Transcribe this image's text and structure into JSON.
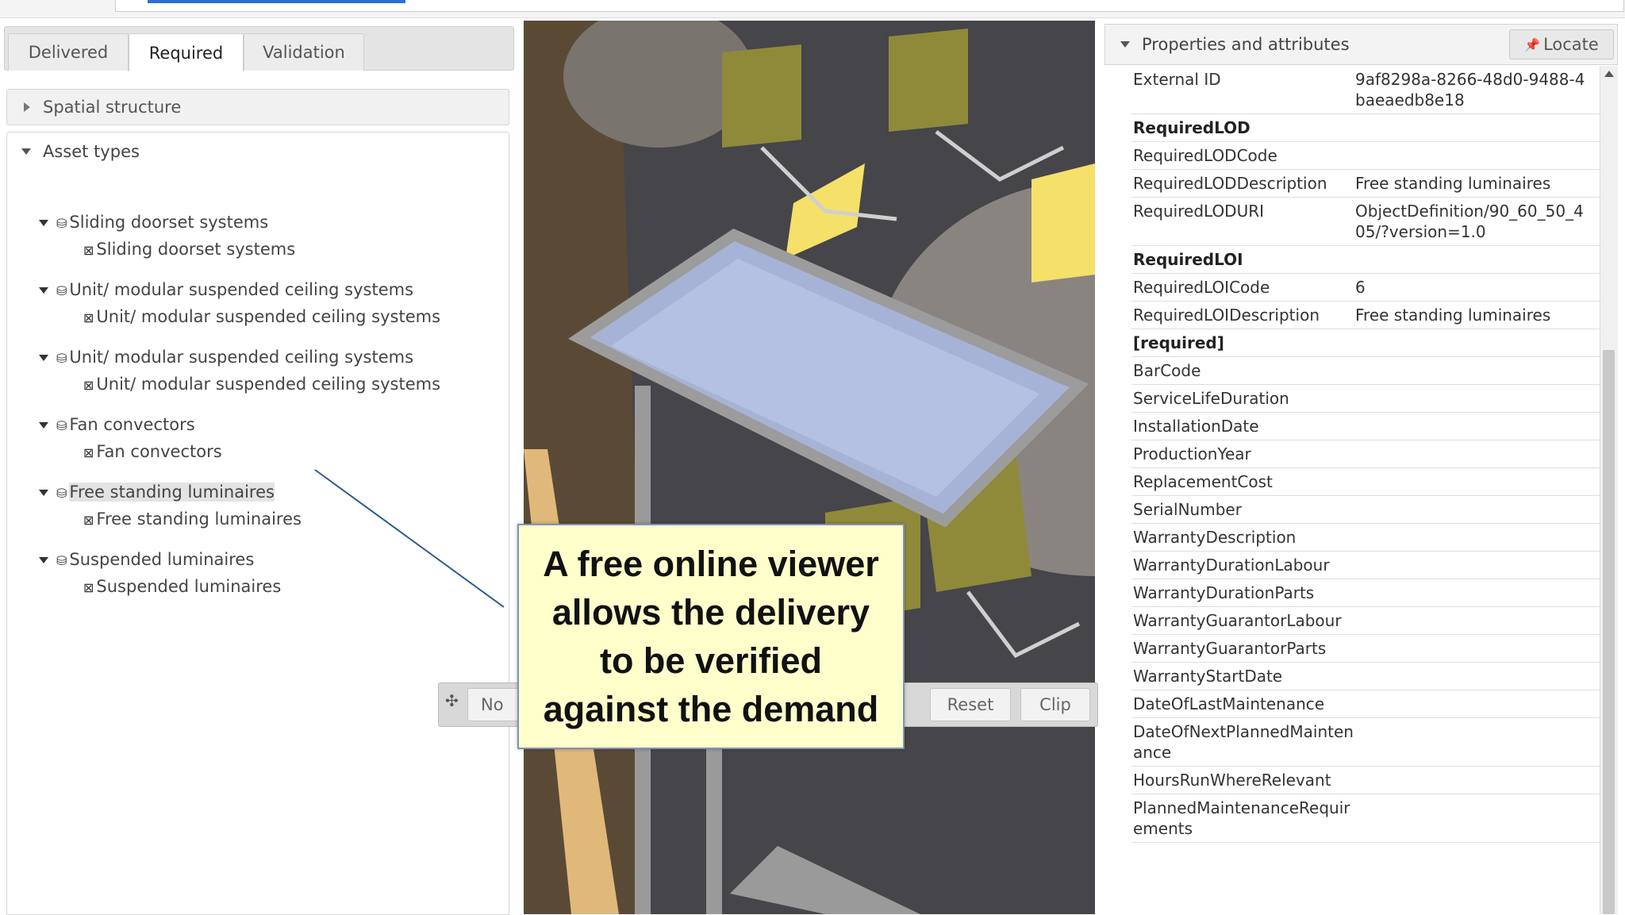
{
  "tabs": [
    "Delivered",
    "Required",
    "Validation"
  ],
  "accordions": {
    "spatial": "Spatial structure",
    "assets": "Asset types"
  },
  "tree": [
    {
      "parent": "Sliding doorset systems",
      "child": "Sliding doorset systems"
    },
    {
      "parent": "Unit/ modular suspended ceiling systems",
      "child": "Unit/ modular suspended ceiling systems"
    },
    {
      "parent": "Unit/ modular suspended ceiling systems",
      "child": "Unit/ modular suspended ceiling systems"
    },
    {
      "parent": "Fan convectors",
      "child": "Fan convectors"
    },
    {
      "parent": "Free standing luminaires",
      "child": "Free standing luminaires"
    },
    {
      "parent": "Suspended luminaires",
      "child": "Suspended luminaires"
    }
  ],
  "viewer_toolbar": {
    "move_icon": "move-icon",
    "mode_partial": "No",
    "reset": "Reset",
    "clip": "Clip"
  },
  "callout": {
    "line1": "A free online viewer",
    "line2": "allows the delivery",
    "line3": "to be verified",
    "line4": "against the demand"
  },
  "properties": {
    "title": "Properties and attributes",
    "locate": "Locate",
    "rows": [
      {
        "k": "External ID",
        "v": "9af8298a-8266-48d0-9488-4baeaedb8e18",
        "hdr": false
      },
      {
        "k": "RequiredLOD",
        "v": "",
        "hdr": true
      },
      {
        "k": "RequiredLODCode",
        "v": "",
        "hdr": false
      },
      {
        "k": "RequiredLODDescription",
        "v": "Free standing luminaires",
        "hdr": false
      },
      {
        "k": "RequiredLODURI",
        "v": "ObjectDefinition/90_60_50_405/?version=1.0",
        "hdr": false
      },
      {
        "k": "RequiredLOI",
        "v": "",
        "hdr": true
      },
      {
        "k": "RequiredLOICode",
        "v": "6",
        "hdr": false
      },
      {
        "k": "RequiredLOIDescription",
        "v": "Free standing luminaires",
        "hdr": false
      },
      {
        "k": "[required]",
        "v": "",
        "hdr": true
      },
      {
        "k": "BarCode",
        "v": "",
        "hdr": false
      },
      {
        "k": "ServiceLifeDuration",
        "v": "",
        "hdr": false
      },
      {
        "k": "InstallationDate",
        "v": "",
        "hdr": false
      },
      {
        "k": "ProductionYear",
        "v": "",
        "hdr": false
      },
      {
        "k": "ReplacementCost",
        "v": "",
        "hdr": false
      },
      {
        "k": "SerialNumber",
        "v": "",
        "hdr": false
      },
      {
        "k": "WarrantyDescription",
        "v": "",
        "hdr": false
      },
      {
        "k": "WarrantyDurationLabour",
        "v": "",
        "hdr": false
      },
      {
        "k": "WarrantyDurationParts",
        "v": "",
        "hdr": false
      },
      {
        "k": "WarrantyGuarantorLabour",
        "v": "",
        "hdr": false
      },
      {
        "k": "WarrantyGuarantorParts",
        "v": "",
        "hdr": false
      },
      {
        "k": "WarrantyStartDate",
        "v": "",
        "hdr": false
      },
      {
        "k": "DateOfLastMaintenance",
        "v": "",
        "hdr": false
      },
      {
        "k": "DateOfNextPlannedMaintenance",
        "v": "",
        "hdr": false
      },
      {
        "k": "HoursRunWhereRelevant",
        "v": "",
        "hdr": false
      },
      {
        "k": "PlannedMaintenanceRequirements",
        "v": "",
        "hdr": false
      }
    ]
  },
  "colors": {
    "callout_bg": "#ffffcc",
    "viewer_floor": "#45454a",
    "furniture": "#8f8a3a"
  }
}
